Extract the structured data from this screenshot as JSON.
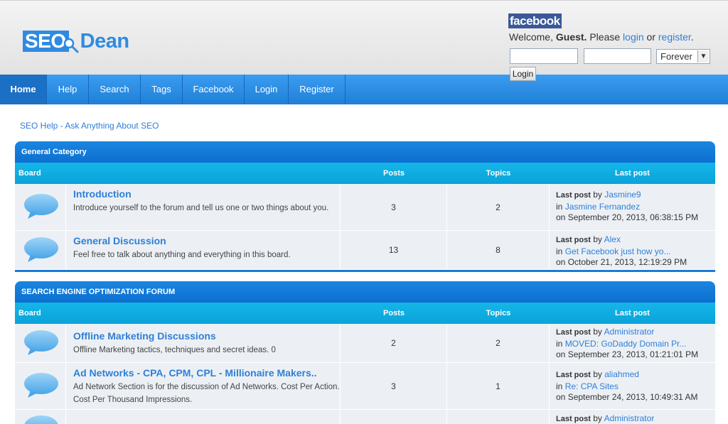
{
  "logo": {
    "part1": "SEO",
    "part2": "Dean"
  },
  "facebook_badge": "facebook",
  "welcome": {
    "prefix": "Welcome, ",
    "guest": "Guest.",
    "please": " Please ",
    "login": "login",
    "or": " or ",
    "register": "register",
    "end": "."
  },
  "login_form": {
    "duration": "Forever",
    "button": "Login"
  },
  "nav": [
    "Home",
    "Help",
    "Search",
    "Tags",
    "Facebook",
    "Login",
    "Register"
  ],
  "breadcrumb": "SEO Help - Ask Anything About SEO",
  "columns": {
    "board": "Board",
    "posts": "Posts",
    "topics": "Topics",
    "last": "Last post"
  },
  "last_post_label": "Last post",
  "by": " by ",
  "in": "in ",
  "on": "on ",
  "categories": [
    {
      "title": "General Category",
      "boards": [
        {
          "name": "Introduction",
          "desc": "Introduce yourself to the forum and tell us one or two things about you.",
          "posts": "3",
          "topics": "2",
          "last_by": "Jasmine9",
          "last_in": "Jasmine Fernandez",
          "last_on": "September 20, 2013, 06:38:15 PM"
        },
        {
          "name": "General Discussion",
          "desc": "Feel free to talk about anything and everything in this board.",
          "posts": "13",
          "topics": "8",
          "last_by": "Alex",
          "last_in": "Get Facebook just how yo...",
          "last_on": "October 21, 2013, 12:19:29 PM"
        }
      ]
    },
    {
      "title": "SEARCH ENGINE OPTIMIZATION FORUM",
      "boards": [
        {
          "name": "Offline Marketing Discussions",
          "desc": "Offline Marketing tactics, techniques and secret ideas. 0",
          "posts": "2",
          "topics": "2",
          "last_by": "Administrator",
          "last_in": "MOVED: GoDaddy Domain Pr...",
          "last_on": "September 23, 2013, 01:21:01 PM"
        },
        {
          "name": "Ad Networks - CPA, CPM, CPL - Millionaire Makers..",
          "desc": "Ad Network Section is for the discussion of Ad Networks. Cost Per Action. Cost Per Thousand Impressions.",
          "posts": "3",
          "topics": "1",
          "last_by": "aliahmed",
          "last_in": "Re: CPA Sites",
          "last_on": "September 24, 2013, 10:49:31 AM"
        },
        {
          "last_by": "Administrator"
        }
      ]
    }
  ],
  "colors": {
    "brand": "#2f8be0",
    "nav": "#2a8de6",
    "facebook": "#3b5998",
    "header_bar": "#0aa3da"
  }
}
